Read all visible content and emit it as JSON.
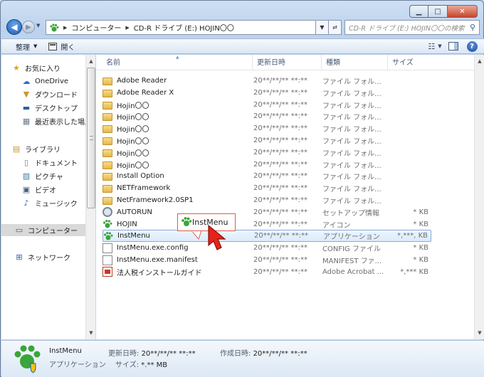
{
  "window": {
    "minimize": "▁",
    "maximize": "□",
    "close": "✕"
  },
  "address": {
    "crumbs": [
      "コンピューター",
      "CD-R ドライブ (E:) HOJIN〇〇"
    ],
    "search_placeholder": "CD-R ドライブ (E:) HOJIN〇〇の検索"
  },
  "toolbar": {
    "organize": "整理",
    "open": "開く"
  },
  "nav": {
    "favorites": "お気に入り",
    "onedrive": "OneDrive",
    "downloads": "ダウンロード",
    "desktop": "デスクトップ",
    "recent": "最近表示した場所",
    "libraries": "ライブラリ",
    "documents": "ドキュメント",
    "pictures": "ピクチャ",
    "videos": "ビデオ",
    "music": "ミュージック",
    "computer": "コンピューター",
    "network": "ネットワーク"
  },
  "columns": {
    "name": "名前",
    "date": "更新日時",
    "type": "種類",
    "size": "サイズ"
  },
  "files": [
    {
      "name": "Adobe Reader",
      "date": "20**/**/**  **:**",
      "type": "ファイル フォル...",
      "size": ""
    },
    {
      "name": "Adobe Reader X",
      "date": "20**/**/**  **:**",
      "type": "ファイル フォル...",
      "size": ""
    },
    {
      "name": "Hojin〇〇",
      "date": "20**/**/**  **:**",
      "type": "ファイル フォル...",
      "size": ""
    },
    {
      "name": "Hojin〇〇",
      "date": "20**/**/**  **:**",
      "type": "ファイル フォル...",
      "size": ""
    },
    {
      "name": "Hojin〇〇",
      "date": "20**/**/**  **:**",
      "type": "ファイル フォル...",
      "size": ""
    },
    {
      "name": "Hojin〇〇",
      "date": "20**/**/**  **:**",
      "type": "ファイル フォル...",
      "size": ""
    },
    {
      "name": "Hojin〇〇",
      "date": "20**/**/**  **:**",
      "type": "ファイル フォル...",
      "size": ""
    },
    {
      "name": "Hojin〇〇",
      "date": "20**/**/**  **:**",
      "type": "ファイル フォル...",
      "size": ""
    },
    {
      "name": "Install Option",
      "date": "20**/**/**  **:**",
      "type": "ファイル フォル...",
      "size": ""
    },
    {
      "name": "NETFramework",
      "date": "20**/**/**  **:**",
      "type": "ファイル フォル...",
      "size": ""
    },
    {
      "name": "NetFramework2.0SP1",
      "date": "20**/**/**  **:**",
      "type": "ファイル フォル...",
      "size": ""
    },
    {
      "name": "AUTORUN",
      "date": "20**/**/**  **:**",
      "type": "セットアップ情報",
      "size": "* KB"
    },
    {
      "name": "HOJIN",
      "date": "20**/**/**  **:**",
      "type": "アイコン",
      "size": "* KB"
    },
    {
      "name": "InstMenu",
      "date": "20**/**/**  **:**",
      "type": "アプリケーション",
      "size": "*,***, KB"
    },
    {
      "name": "InstMenu.exe.config",
      "date": "20**/**/**  **:**",
      "type": "CONFIG ファイル",
      "size": "* KB"
    },
    {
      "name": "InstMenu.exe.manifest",
      "date": "20**/**/**  **:**",
      "type": "MANIFEST ファ...",
      "size": "* KB"
    },
    {
      "name": "法人税インストールガイド",
      "date": "20**/**/**  **:**",
      "type": "Adobe Acrobat ...",
      "size": "*,*** KB"
    }
  ],
  "tooltip": "InstMenu",
  "details": {
    "name": "InstMenu",
    "type": "アプリケーション",
    "modified_label": "更新日時:",
    "modified": "20**/**/**  **:**",
    "created_label": "作成日時:",
    "created": "20**/**/**  **:**",
    "size_label": "サイズ:",
    "size": "*.** MB"
  }
}
